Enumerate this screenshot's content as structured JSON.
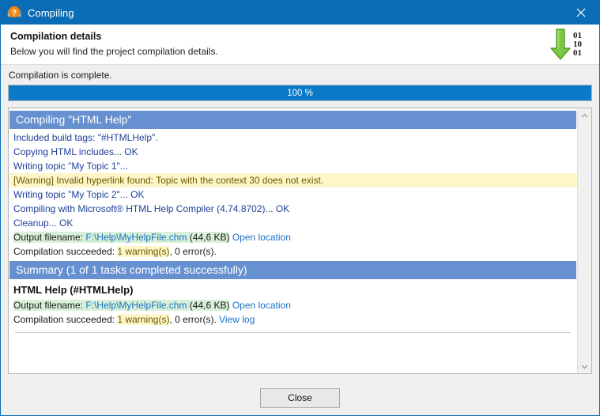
{
  "window": {
    "title": "Compiling",
    "title_icon": "help-compile-icon",
    "close_icon": "close-icon"
  },
  "header": {
    "title": "Compilation details",
    "subtitle": "Below you will find the project compilation details.",
    "icon": "binary-download-arrow-icon"
  },
  "status": {
    "text": "Compilation is complete."
  },
  "progress": {
    "label": "100 %",
    "percent": 100,
    "fill_color": "#0a7ac8"
  },
  "log": {
    "compiling_section": {
      "header": "Compiling \"HTML Help\"",
      "lines": [
        {
          "type": "plain",
          "text": "Included build tags: \"#HTMLHelp\"."
        },
        {
          "type": "plain",
          "text": "Copying HTML includes... OK"
        },
        {
          "type": "plain",
          "text": "Writing topic \"My Topic 1\"..."
        },
        {
          "type": "warning",
          "text": "[Warning] Invalid hyperlink found: Topic with the context 30 does not exist."
        },
        {
          "type": "plain",
          "text": "Writing topic \"My Topic 2\"... OK"
        },
        {
          "type": "plain",
          "text": "Compiling with Microsoft® HTML Help Compiler (4.74.8702)... OK"
        },
        {
          "type": "plain",
          "text": "Cleanup... OK"
        }
      ],
      "output_line": {
        "label": "Output filename:",
        "path": "F:\\Help\\MyHelpFile.chm",
        "size": "(44,6 KB)",
        "open_location": "Open location"
      },
      "result_line": {
        "prefix": "Compilation succeeded:",
        "warnings": "1 warning(s)",
        "errors": ", 0 error(s)."
      }
    },
    "summary_section": {
      "header": "Summary (1 of 1 tasks completed successfully)",
      "task_title": "HTML Help (#HTMLHelp)",
      "output_line": {
        "label": "Output filename:",
        "path": "F:\\Help\\MyHelpFile.chm",
        "size": "(44,6 KB)",
        "open_location": "Open location"
      },
      "result_line": {
        "prefix": "Compilation succeeded:",
        "warnings": "1 warning(s)",
        "errors": ", 0 error(s).",
        "view_log": "View log"
      }
    },
    "scrollbar": {
      "up_arrow": "chevron-up-icon",
      "down_arrow": "chevron-down-icon"
    }
  },
  "footer": {
    "close_label": "Close"
  },
  "colors": {
    "titlebar": "#0a6cb4",
    "section_header": "#6690d0",
    "link": "#1a6fc4",
    "log_text": "#20419a",
    "warning_bg": "#fdf6c8",
    "success_bg": "#d7f0d7"
  }
}
